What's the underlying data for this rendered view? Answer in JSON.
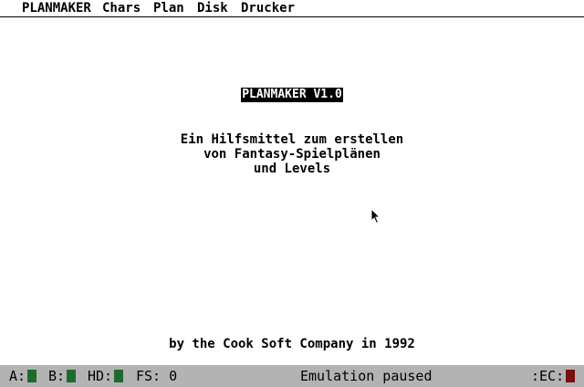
{
  "menu": {
    "app": "PLANMAKER",
    "chars": "Chars",
    "plan": "Plan",
    "disk": "Disk",
    "drucker": "Drucker"
  },
  "content": {
    "title": "PLANMAKER V1.0",
    "description": [
      "Ein Hilfsmittel zum erstellen",
      "von Fantasy-Spielplänen",
      "und Levels"
    ],
    "credit": "by the Cook Soft Company in 1992"
  },
  "statusbar": {
    "drive_a_label": "A:",
    "drive_b_label": "B:",
    "hd_label": "HD:",
    "fs_label": "FS:",
    "fs_value": "0",
    "status_text": "Emulation paused",
    "ec_label": ":EC:"
  },
  "colors": {
    "led_green": "#1f6b2e",
    "led_red": "#7a0f0f",
    "statusbar_bg": "#b3b3b3"
  }
}
